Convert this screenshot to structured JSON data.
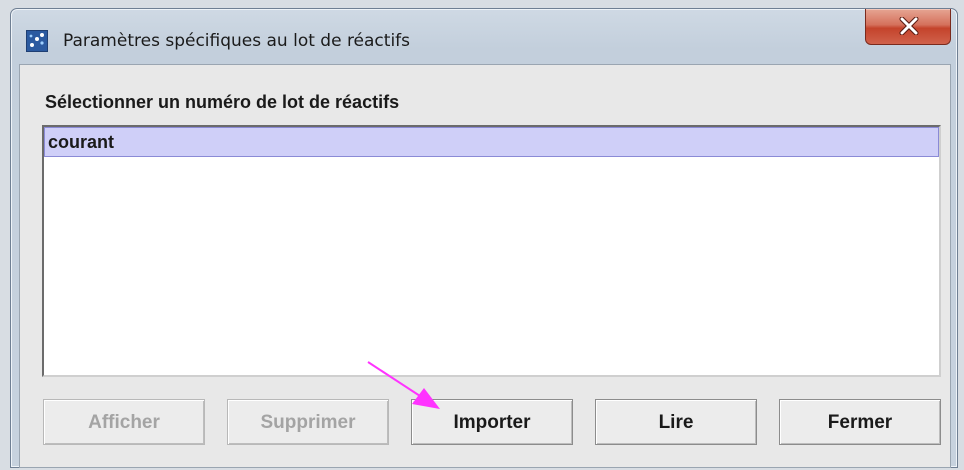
{
  "window": {
    "title": "Paramètres spécifiques au lot de réactifs",
    "icon": "app-icon",
    "close_icon": "close-icon"
  },
  "section_label": "Sélectionner un numéro de lot de réactifs",
  "list": {
    "items": [
      {
        "label": "courant",
        "selected": true
      }
    ]
  },
  "buttons": {
    "afficher": "Afficher",
    "supprimer": "Supprimer",
    "importer": "Importer",
    "lire": "Lire",
    "fermer": "Fermer"
  },
  "colors": {
    "selection": "#cfcff8",
    "annotation_arrow": "#ff33ff",
    "close_button": "#c4432b"
  }
}
